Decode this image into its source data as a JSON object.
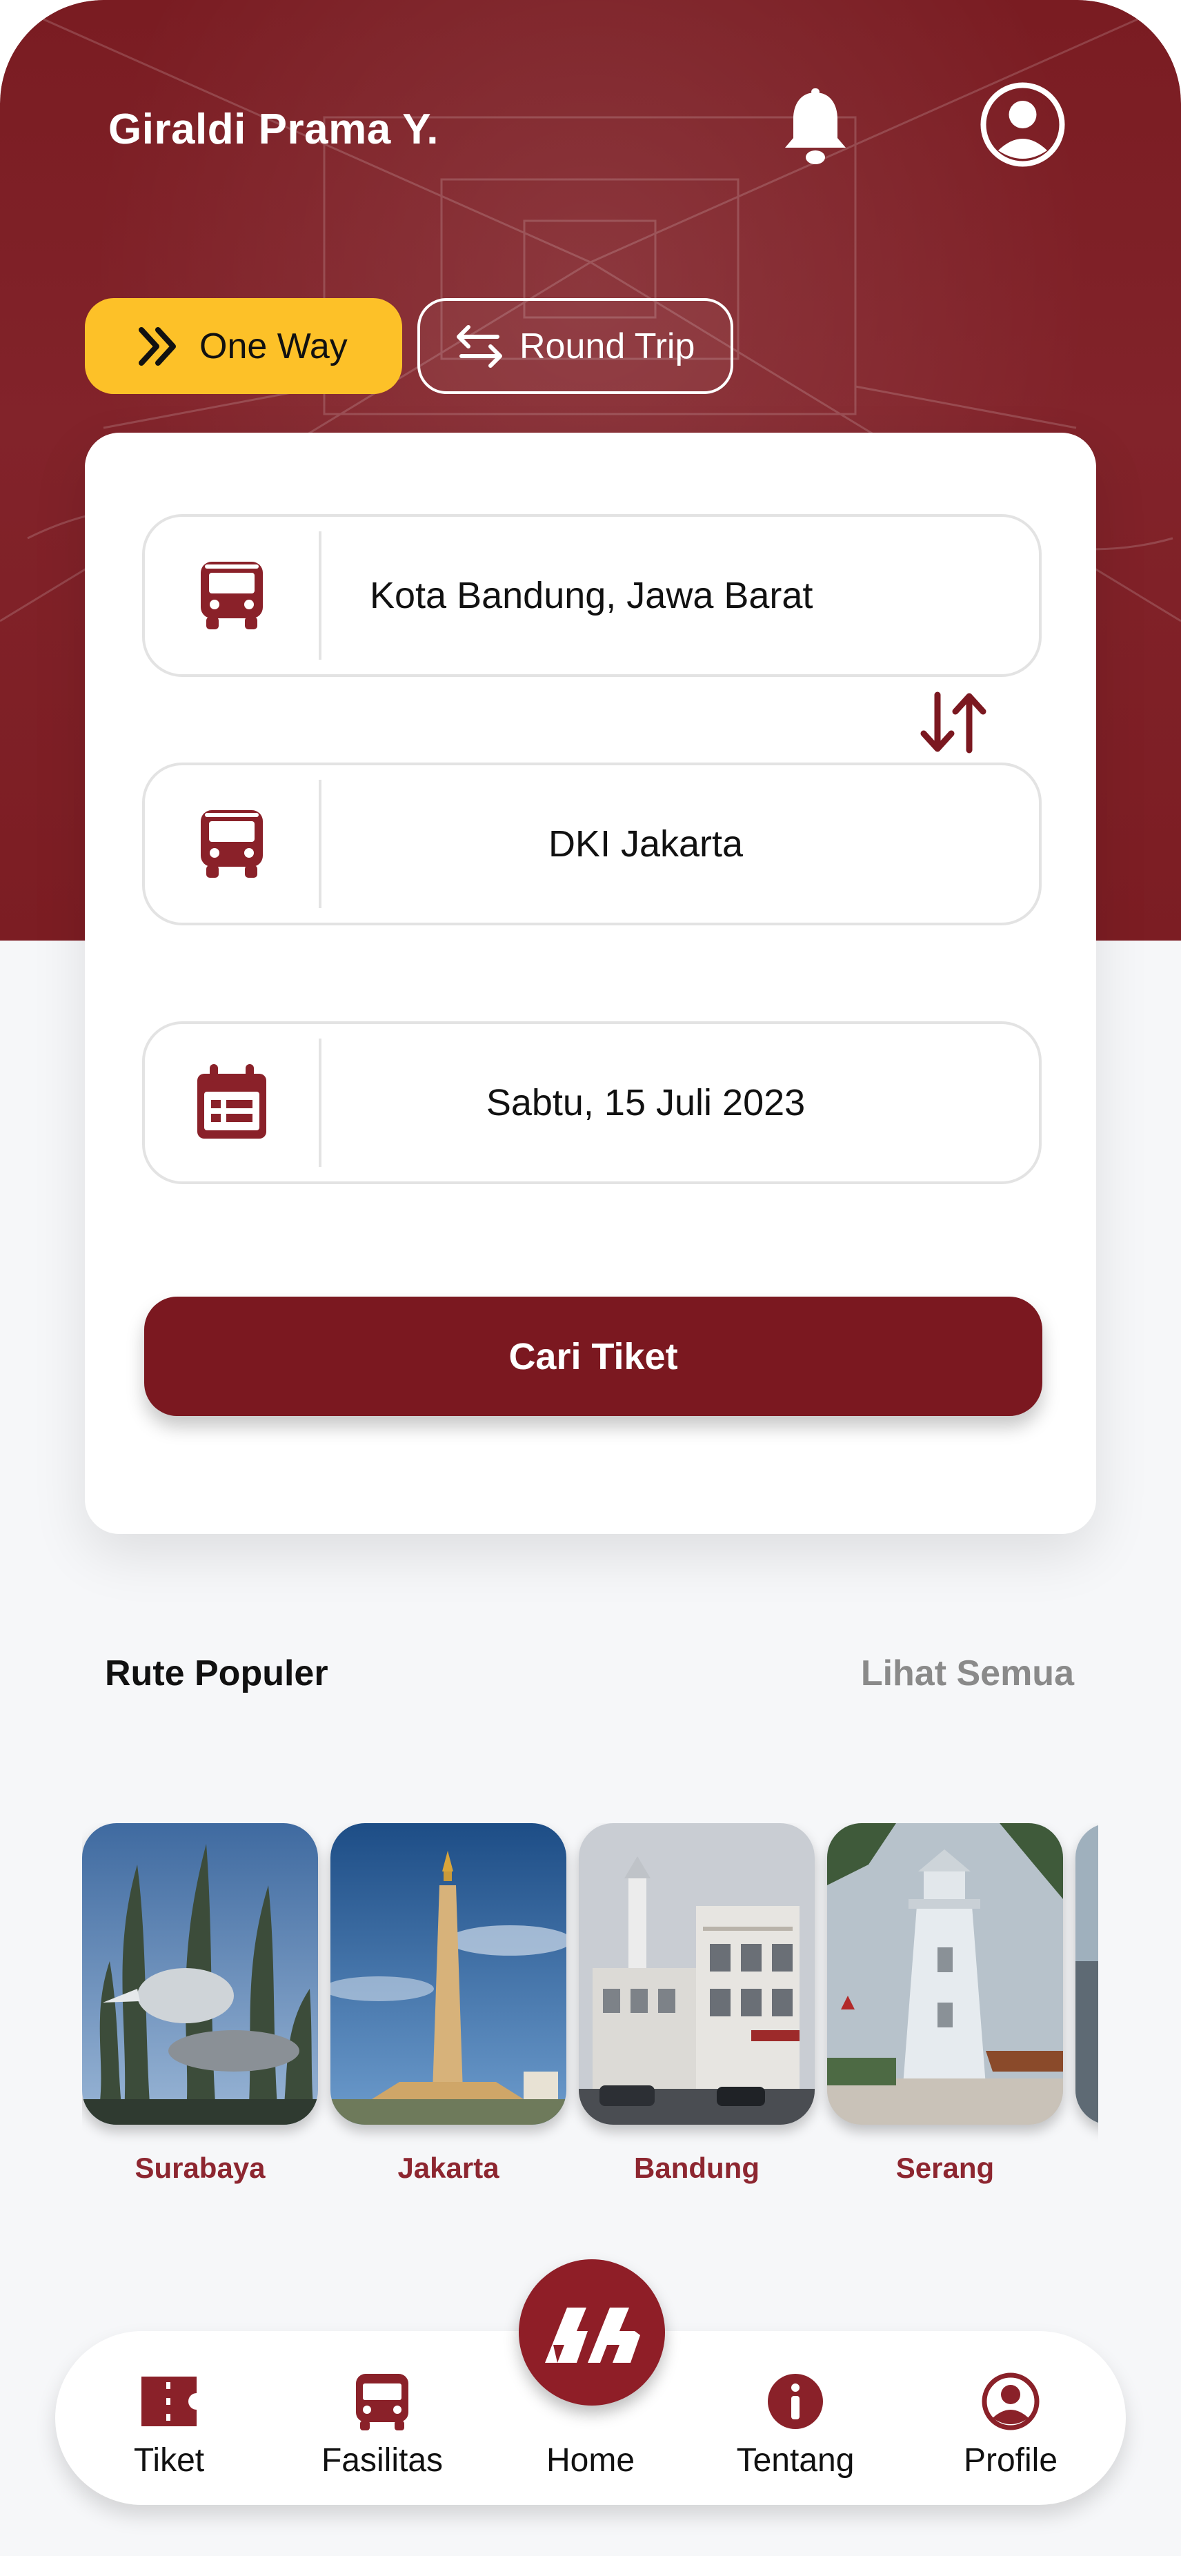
{
  "header": {
    "user_name": "Giraldi Prama Y.",
    "notification_icon": "bell-icon",
    "profile_icon": "user-circle-icon"
  },
  "trip_type": {
    "one_way_label": "One Way",
    "round_trip_label": "Round Trip",
    "selected": "One Way"
  },
  "search_form": {
    "origin": "Kota Bandung, Jawa Barat",
    "destination": "DKI Jakarta",
    "date": "Sabtu, 15 Juli 2023",
    "search_button": "Cari Tiket"
  },
  "popular": {
    "title": "Rute Populer",
    "see_all": "Lihat Semua",
    "routes": [
      {
        "city": "Surabaya"
      },
      {
        "city": "Jakarta"
      },
      {
        "city": "Bandung"
      },
      {
        "city": "Serang"
      }
    ]
  },
  "nav": {
    "items": [
      {
        "label": "Tiket",
        "icon": "ticket-icon"
      },
      {
        "label": "Fasilitas",
        "icon": "bus-icon"
      },
      {
        "label": "Home",
        "icon": "home-logo-icon"
      },
      {
        "label": "Tentang",
        "icon": "info-icon"
      },
      {
        "label": "Profile",
        "icon": "user-circle-icon"
      }
    ]
  },
  "colors": {
    "brand": "#7b1820",
    "accent": "#fdc128",
    "caption": "#8d2630",
    "muted": "#8a8a8a"
  }
}
